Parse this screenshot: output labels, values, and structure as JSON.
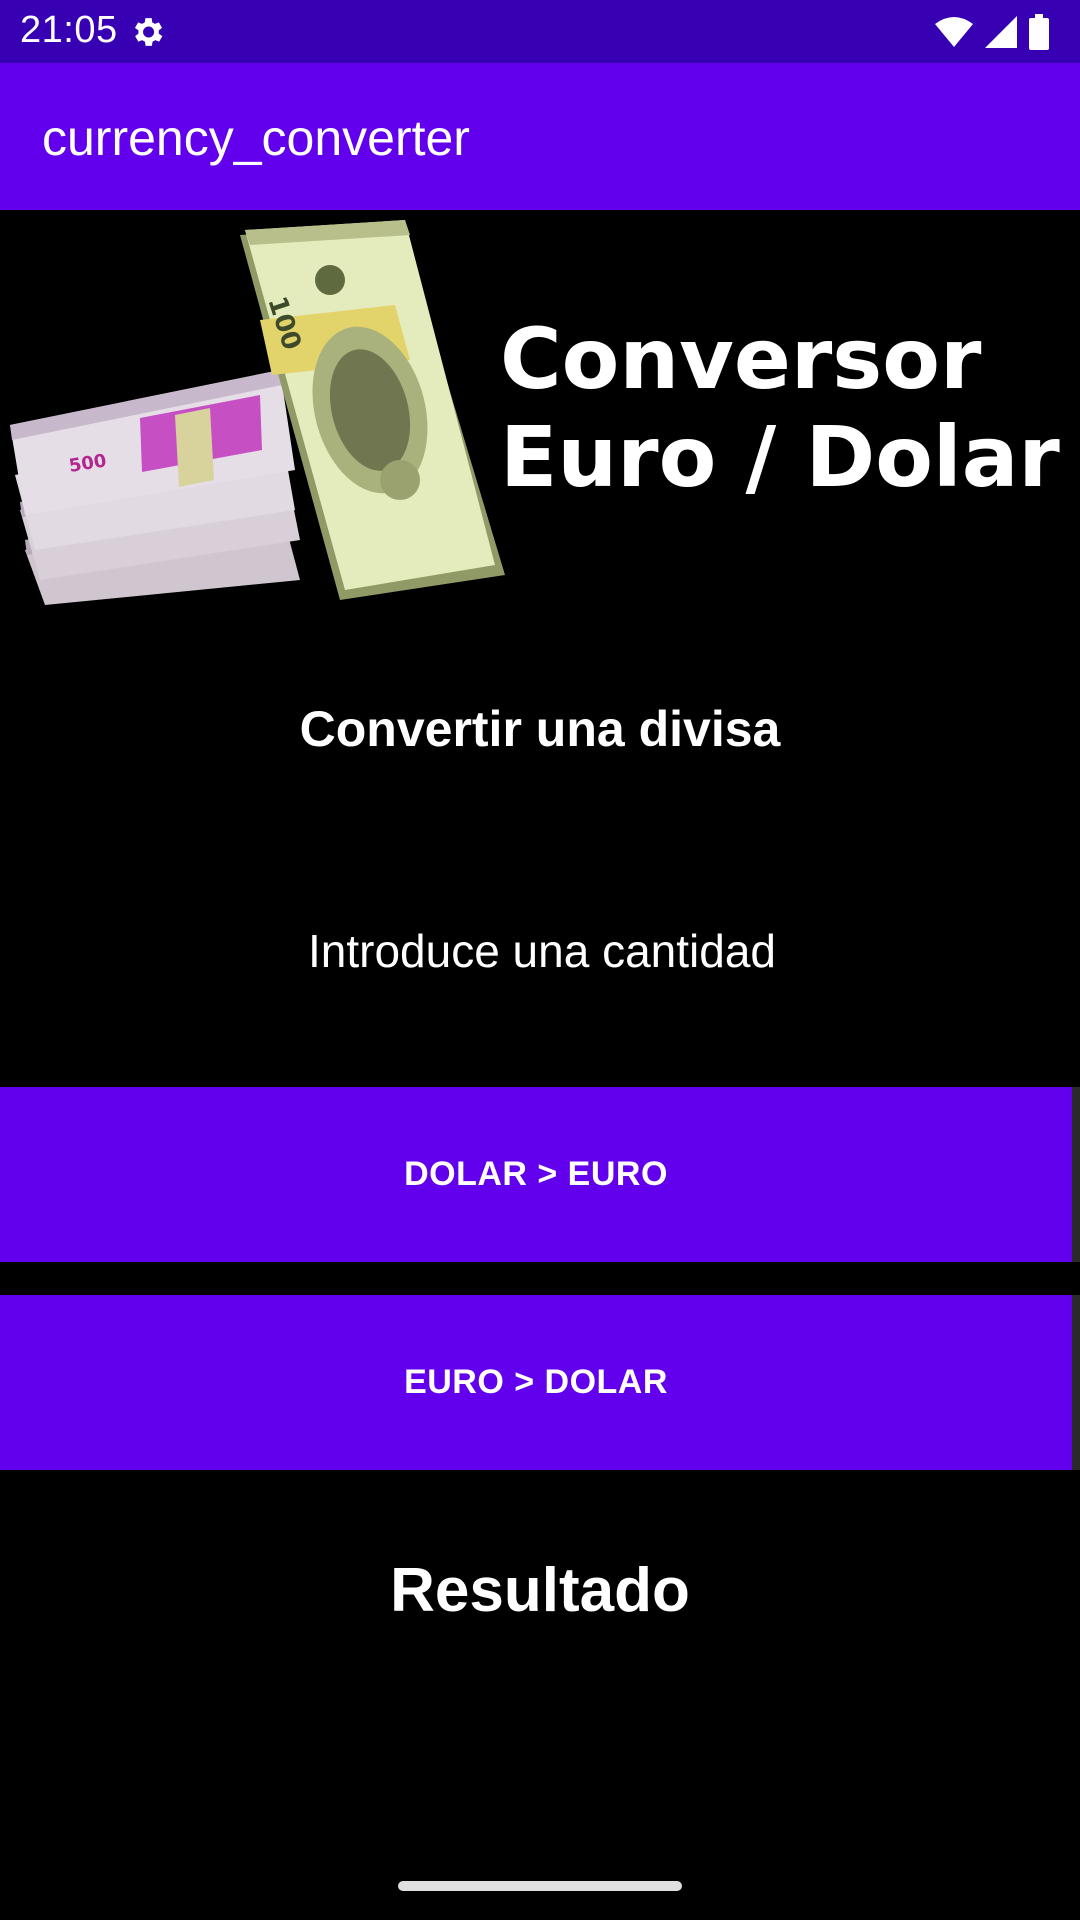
{
  "status_bar": {
    "time": "21:05",
    "icons": [
      "gear-icon",
      "wifi-icon",
      "signal-icon",
      "battery-icon"
    ]
  },
  "app_bar": {
    "title": "currency_converter"
  },
  "banner": {
    "line1": "Conversor",
    "line2": "Euro / Dolar",
    "image": "money-stacks-image",
    "euro_note_label": "500",
    "dollar_note_label": "100"
  },
  "main": {
    "section_title": "Convertir una divisa",
    "amount_placeholder": "Introduce una cantidad",
    "amount_value": "",
    "btn_dolar_euro": "DOLAR > EURO",
    "btn_euro_dolar": "EURO > DOLAR",
    "result_label": "Resultado"
  },
  "colors": {
    "status_bar": "#3700b3",
    "primary": "#6200ee",
    "background": "#000000",
    "text": "#ffffff"
  }
}
